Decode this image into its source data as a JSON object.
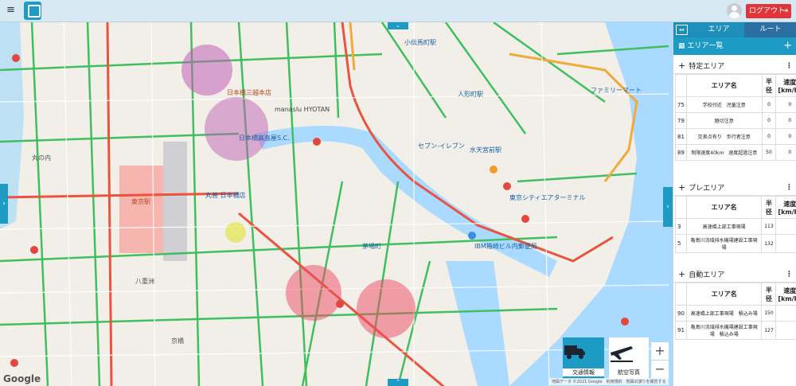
{
  "header": {
    "logout_label": "ログアウト",
    "logout_icon": "logout-icon"
  },
  "map": {
    "traffic_label": "交通情報",
    "aerial_label": "航空写真",
    "zoom_in": "+",
    "zoom_out": "−",
    "google": "Google",
    "attribution": "地図データ ©2021 Google　利用規約　地図の誤りを報告する",
    "labels": {
      "nihonbashi_mitsukoshi": "日本橋三越本店",
      "tokyo_st": "東京駅",
      "maruzen": "丸善 日本橋店",
      "takashimaya": "日本橋高島屋S.C.",
      "suitengu": "水天宮前駅",
      "ningyocho": "人形町駅",
      "hyotan": "manaslu HYOTAN",
      "ibm": "IBM箱崎ビル内郵便局",
      "family_mart": "ファミリーマート",
      "seven": "セブン-イレブン",
      "kayabacho": "茅場町",
      "tokyo_city_air": "東京シティエアターミナル",
      "kodenmacho": "小伝馬町駅",
      "yaesu": "八重洲",
      "kyobashi": "京橋",
      "marunouchi": "丸の内"
    }
  },
  "panel": {
    "tab_area": "エリア",
    "tab_route": "ルート",
    "expand_icon": "↔",
    "list_title": "エリア一覧",
    "add_icon": "+",
    "sections": [
      {
        "title": "特定エリア",
        "col_name": "エリア名",
        "col_1": "半径",
        "col_2": "速度[km/h]",
        "rows": [
          {
            "id": "75",
            "name": "学校付近　児童注意",
            "c1": "0",
            "c2": "0"
          },
          {
            "id": "79",
            "name": "踏切注意",
            "c1": "0",
            "c2": "0"
          },
          {
            "id": "81",
            "name": "交差点有り　歩行者注意",
            "c1": "0",
            "c2": "0"
          },
          {
            "id": "89",
            "name": "制限速度40km　速度超過注意",
            "c1": "50",
            "c2": "0"
          }
        ]
      },
      {
        "title": "プレエリア",
        "col_name": "エリア名",
        "col_1": "半径",
        "col_2": "速度[km/h]",
        "rows": [
          {
            "id": "3",
            "name": "高速橋上部工事現場",
            "c1": "113",
            "c2": ""
          },
          {
            "id": "5",
            "name": "亀島川流域排水機場建設工事現場",
            "c1": "132",
            "c2": ""
          }
        ]
      },
      {
        "title": "自動エリア",
        "col_name": "エリア名",
        "col_1": "半径",
        "col_2": "速度[km/h]",
        "rows": [
          {
            "id": "90",
            "name": "高速橋上部工事現場　積込み場",
            "c1": "150",
            "c2": ""
          },
          {
            "id": "91",
            "name": "亀島川流域排水機場建設工事現場　積込み場",
            "c1": "127",
            "c2": ""
          }
        ]
      }
    ]
  }
}
